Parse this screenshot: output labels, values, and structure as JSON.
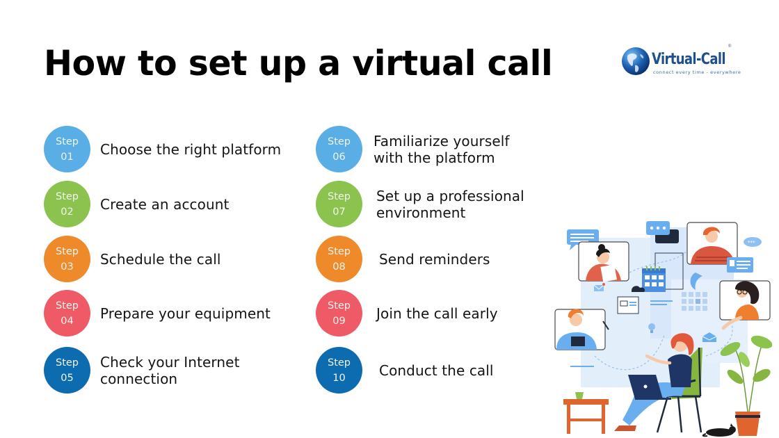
{
  "title": "How to set up a virtual call",
  "logo": {
    "brand": "Virtual-Call",
    "tagline": "connect every time - everywhere",
    "registered_mark": "®"
  },
  "badge_prefix": "Step",
  "steps": [
    {
      "number": "01",
      "label": "Choose the right platform",
      "color": "#5aaee6"
    },
    {
      "number": "02",
      "label": "Create an account",
      "color": "#8cc34f"
    },
    {
      "number": "03",
      "label": "Schedule the call",
      "color": "#ef8a2b"
    },
    {
      "number": "04",
      "label": "Prepare your equipment",
      "color": "#ee5a66"
    },
    {
      "number": "05",
      "label": "Check your Internet\nconnection",
      "color": "#0d6bb0"
    },
    {
      "number": "06",
      "label": "Familiarize yourself\nwith the platform",
      "color": "#5aaee6"
    },
    {
      "number": "07",
      "label": "Set up a professional\nenvironment",
      "color": "#8cc34f"
    },
    {
      "number": "08",
      "label": "Send reminders",
      "color": "#ef8a2b"
    },
    {
      "number": "09",
      "label": "Join the call early",
      "color": "#ee5a66"
    },
    {
      "number": "10",
      "label": "Conduct the call",
      "color": "#0d6bb0"
    }
  ],
  "illustration": {
    "subject": "woman on laptop in armchair joining a video call with four participants"
  }
}
